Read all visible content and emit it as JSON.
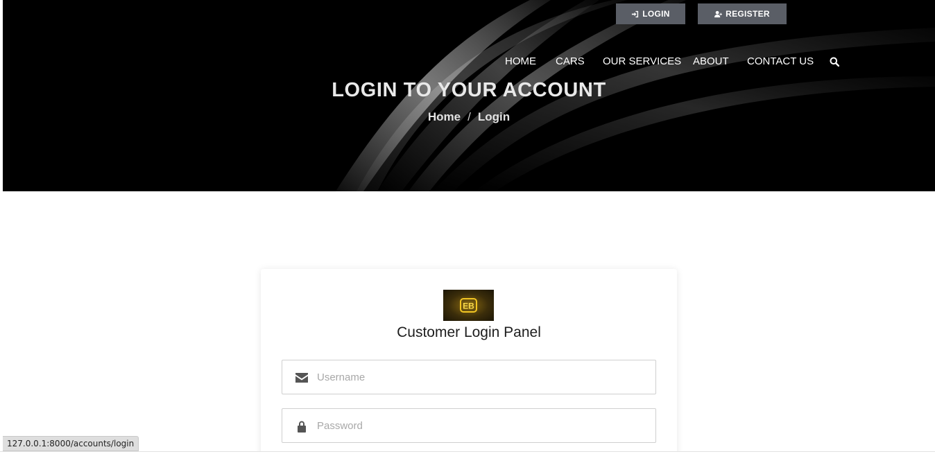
{
  "header": {
    "login_label": "LOGIN",
    "register_label": "REGISTER",
    "nav": [
      "HOME",
      "CARS",
      "OUR SERVICES",
      "ABOUT",
      "CONTACT US"
    ],
    "title": "LOGIN TO YOUR ACCOUNT",
    "breadcrumb": {
      "home": "Home",
      "separator": "/",
      "current": "Login"
    }
  },
  "login_panel": {
    "title": "Customer Login Panel",
    "logo_text": "EB",
    "username_placeholder": "Username",
    "password_placeholder": "Password"
  },
  "status_url": "127.0.0.1:8000/accounts/login",
  "icons": {
    "login": "sign-in-icon",
    "register": "user-plus-icon",
    "search": "search-icon",
    "username": "envelope-icon",
    "password": "lock-icon"
  },
  "colors": {
    "hero_bg": "#000000",
    "top_button_bg": "#5a5e66",
    "logo_gold": "#f3c623"
  }
}
